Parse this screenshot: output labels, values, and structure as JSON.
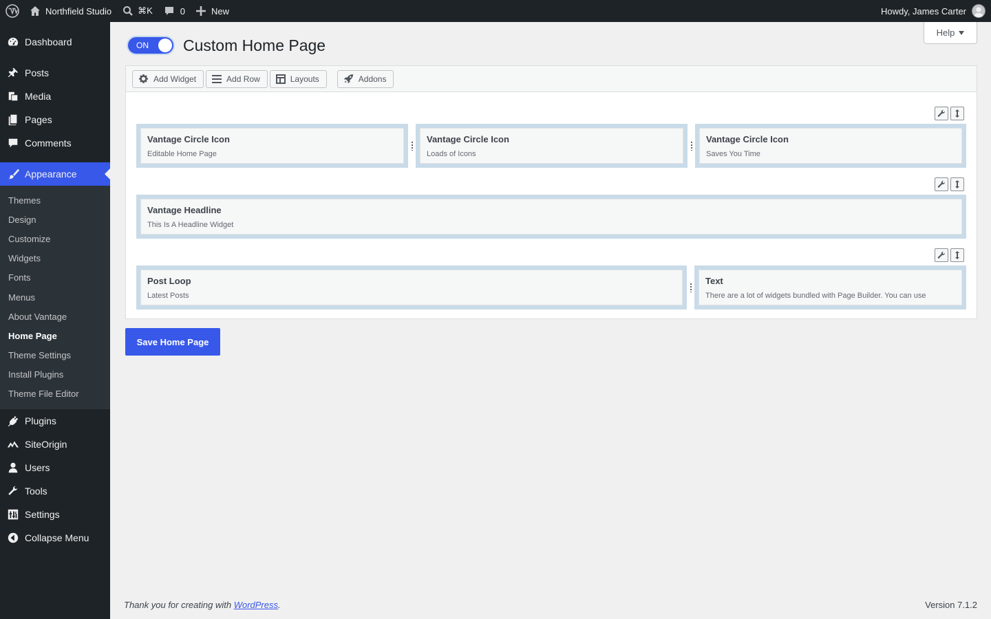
{
  "adminbar": {
    "site_name": "Northfield Studio",
    "search_shortcut": "⌘K",
    "comments_count": "0",
    "new_label": "New",
    "howdy": "Howdy, James Carter"
  },
  "sidebar": {
    "items_top": [
      {
        "label": "Dashboard",
        "icon": "dashboard-icon"
      },
      {
        "label": "Posts",
        "icon": "pin-icon"
      },
      {
        "label": "Media",
        "icon": "media-icon"
      },
      {
        "label": "Pages",
        "icon": "pages-icon"
      },
      {
        "label": "Comments",
        "icon": "comment-icon"
      }
    ],
    "current": {
      "label": "Appearance",
      "icon": "paintbrush-icon"
    },
    "submenu": [
      "Themes",
      "Design",
      "Customize",
      "Widgets",
      "Fonts",
      "Menus",
      "About Vantage",
      "Home Page",
      "Theme Settings",
      "Install Plugins",
      "Theme File Editor"
    ],
    "submenu_active": "Home Page",
    "items_bottom": [
      {
        "label": "Plugins",
        "icon": "plugin-icon"
      },
      {
        "label": "SiteOrigin",
        "icon": "siteorigin-icon"
      },
      {
        "label": "Users",
        "icon": "user-icon"
      },
      {
        "label": "Tools",
        "icon": "wrench-icon"
      },
      {
        "label": "Settings",
        "icon": "settings-icon"
      },
      {
        "label": "Collapse Menu",
        "icon": "collapse-icon"
      }
    ]
  },
  "main": {
    "help_label": "Help",
    "toggle_label": "ON",
    "page_title": "Custom Home Page",
    "toolbar": {
      "add_widget": "Add Widget",
      "add_row": "Add Row",
      "layouts": "Layouts",
      "addons": "Addons"
    },
    "rows": [
      {
        "widgets": [
          {
            "title": "Vantage Circle Icon",
            "desc": "Editable Home Page"
          },
          {
            "title": "Vantage Circle Icon",
            "desc": "Loads of Icons"
          },
          {
            "title": "Vantage Circle Icon",
            "desc": "Saves You Time"
          }
        ]
      },
      {
        "widgets": [
          {
            "title": "Vantage Headline",
            "desc": "This Is A Headline Widget"
          }
        ]
      },
      {
        "widgets": [
          {
            "title": "Post Loop",
            "desc": "Latest Posts"
          },
          {
            "title": "Text",
            "desc": "There are a lot of widgets bundled with Page Builder. You can use"
          }
        ]
      }
    ],
    "save_label": "Save Home Page"
  },
  "footer": {
    "thanks_prefix": "Thank you for creating with ",
    "link_text": "WordPress",
    "thanks_suffix": ".",
    "version": "Version 7.1.2"
  },
  "colors": {
    "accent": "#3858e9",
    "adminbar": "#1d2327",
    "cell_bg": "#c9dbe8"
  }
}
